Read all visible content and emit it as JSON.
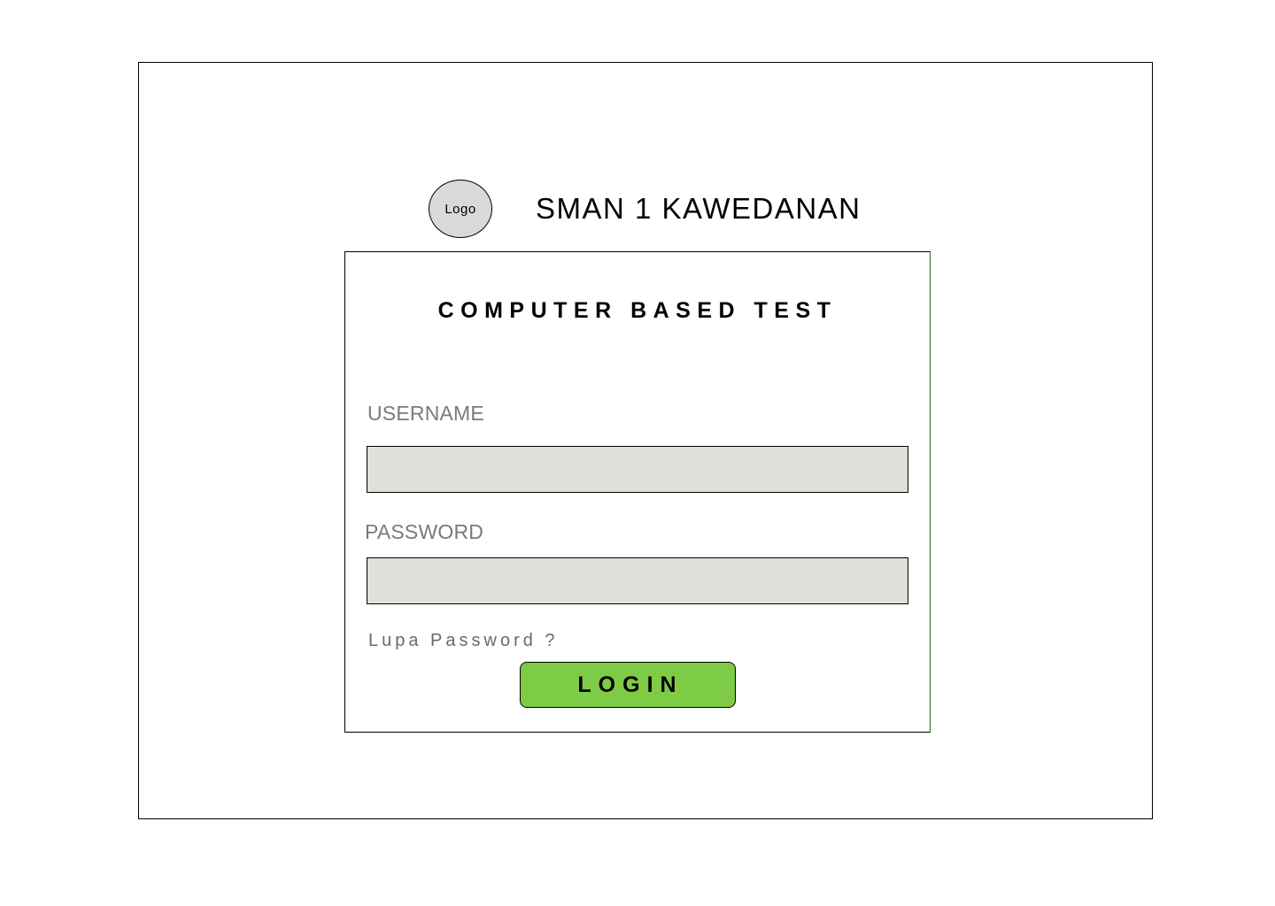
{
  "header": {
    "logo_text": "Logo",
    "school_name": "SMAN 1 KAWEDANAN"
  },
  "login_card": {
    "title": "COMPUTER BASED TEST",
    "username_label": "USERNAME",
    "username_value": "",
    "password_label": "PASSWORD",
    "password_value": "",
    "forgot_password": "Lupa Password ?",
    "login_button": "LOGIN"
  },
  "colors": {
    "login_button": "#7ecb46",
    "field_background": "#e0e0db",
    "logo_background": "#d9d9d9",
    "label_text": "#7a7a7a"
  }
}
